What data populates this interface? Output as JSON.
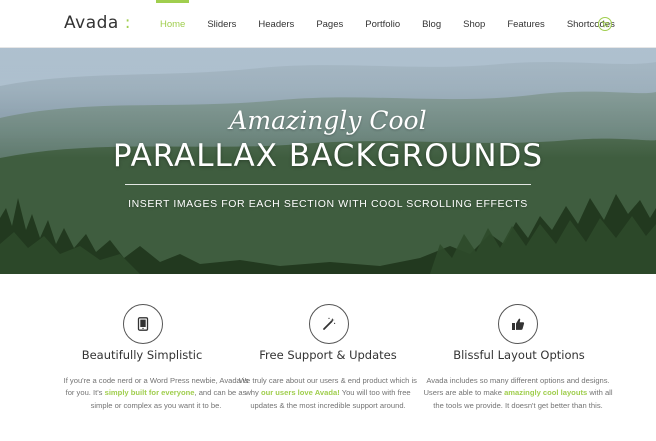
{
  "header": {
    "logo_main": "Avada",
    "logo_accent": " :",
    "nav": [
      {
        "label": "Home",
        "active": true
      },
      {
        "label": "Sliders",
        "active": false
      },
      {
        "label": "Headers",
        "active": false
      },
      {
        "label": "Pages",
        "active": false
      },
      {
        "label": "Portfolio",
        "active": false
      },
      {
        "label": "Blog",
        "active": false
      },
      {
        "label": "Shop",
        "active": false
      },
      {
        "label": "Features",
        "active": false
      },
      {
        "label": "Shortcodes",
        "active": false
      }
    ],
    "cart_icon": "cart-icon"
  },
  "hero": {
    "subtitle": "Amazingly Cool",
    "title": "PARALLAX BACKGROUNDS",
    "tagline": "INSERT IMAGES FOR EACH SECTION WITH COOL SCROLLING EFFECTS"
  },
  "features": [
    {
      "icon": "tablet-icon",
      "title": "Beautifully Simplistic",
      "lines": [
        [
          {
            "t": "If you're a code nerd or a Word Press newbie, Avada is"
          }
        ],
        [
          {
            "t": "for you. It's "
          },
          {
            "t": "simply built for everyone",
            "hl": true
          },
          {
            "t": ", and can be as"
          }
        ],
        [
          {
            "t": "simple or complex as you want it to be."
          }
        ]
      ]
    },
    {
      "icon": "magic-wand-icon",
      "title": "Free Support & Updates",
      "lines": [
        [
          {
            "t": "We truly care about our users & end product which is"
          }
        ],
        [
          {
            "t": "why "
          },
          {
            "t": "our users love Avada!",
            "hl": true
          },
          {
            "t": " You will too with free"
          }
        ],
        [
          {
            "t": "updates & the most incredible support around."
          }
        ]
      ]
    },
    {
      "icon": "thumbs-up-icon",
      "title": "Blissful Layout Options",
      "lines": [
        [
          {
            "t": "Avada includes so many different options and designs."
          }
        ],
        [
          {
            "t": "Users are able to make "
          },
          {
            "t": "amazingly cool layouts",
            "hl": true
          },
          {
            "t": " with all"
          }
        ],
        [
          {
            "t": "the tools we provide. It doesn't get better than this."
          }
        ]
      ]
    }
  ],
  "colors": {
    "accent": "#a0ce4e",
    "text": "#333333",
    "body_text": "#747474"
  }
}
